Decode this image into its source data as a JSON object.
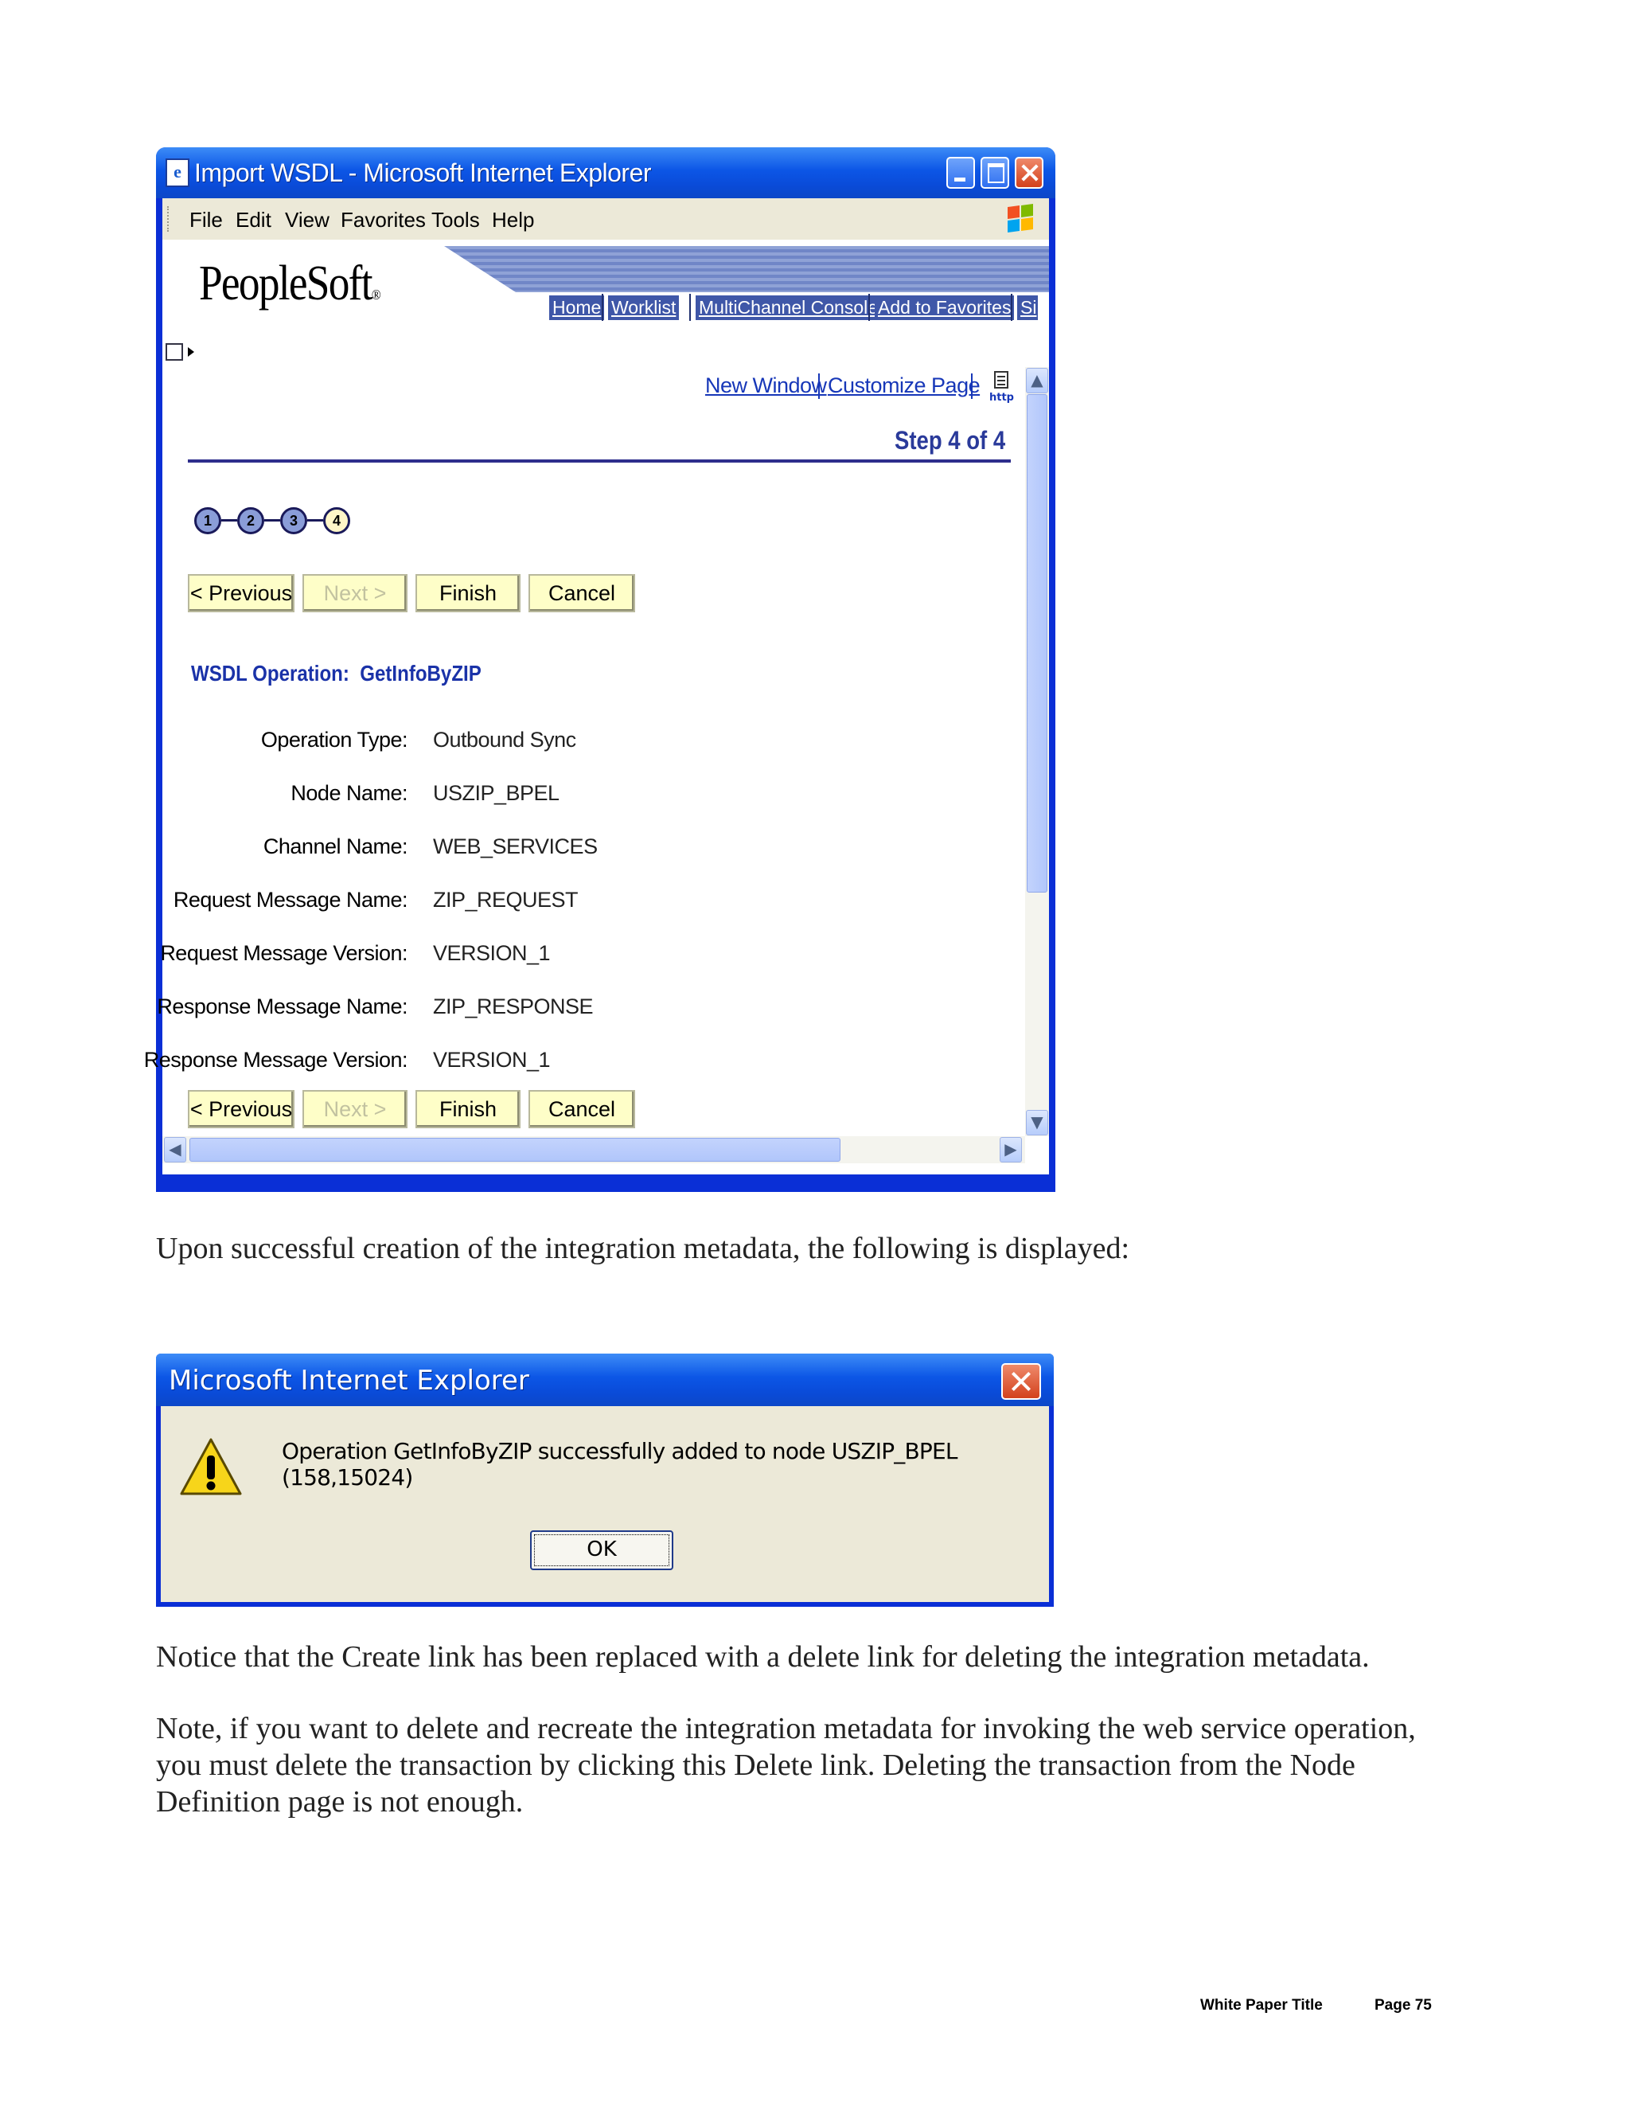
{
  "ie_window": {
    "title": "Import WSDL - Microsoft Internet Explorer",
    "menu": [
      "File",
      "Edit",
      "View",
      "Favorites",
      "Tools",
      "Help"
    ],
    "logo": "PeopleSoft",
    "logo_mark": "®",
    "nav_links": [
      "Home",
      "Worklist",
      "MultiChannel Console",
      "Add to Favorites",
      "Si"
    ],
    "page_links": {
      "new_window": "New Window",
      "customize_page": "Customize Page",
      "http_icon_label": "http"
    },
    "step_label": "Step 4 of 4",
    "steps": [
      "1",
      "2",
      "3",
      "4"
    ],
    "current_step": 4,
    "buttons": {
      "previous": "< Previous",
      "next": "Next >",
      "finish": "Finish",
      "cancel": "Cancel"
    },
    "wsdl_operation_label": "WSDL Operation:",
    "wsdl_operation_value": "GetInfoByZIP",
    "fields": [
      {
        "label": "Operation Type:",
        "value": "Outbound Sync"
      },
      {
        "label": "Node Name:",
        "value": "USZIP_BPEL"
      },
      {
        "label": "Channel Name:",
        "value": "WEB_SERVICES"
      },
      {
        "label": "Request Message Name:",
        "value": "ZIP_REQUEST"
      },
      {
        "label": "Request Message Version:",
        "value": "VERSION_1"
      },
      {
        "label": "Response Message Name:",
        "value": "ZIP_RESPONSE"
      },
      {
        "label": "Response Message Version:",
        "value": "VERSION_1"
      }
    ],
    "scroll": {
      "up": "▲",
      "down": "▼",
      "left": "◀",
      "right": "▶"
    }
  },
  "paragraphs": {
    "p1": "Upon successful creation of the integration metadata, the following is displayed:",
    "p2": "Notice that the Create link has been replaced with a delete link for deleting the integration metadata.",
    "p3": "Note, if you want to delete and recreate the integration metadata for invoking the web service operation, you must delete the transaction by clicking this Delete link. Deleting the transaction from the Node Definition page is not enough."
  },
  "message_box": {
    "title": "Microsoft Internet Explorer",
    "message": "Operation GetInfoByZIP successfully added to node USZIP_BPEL (158,15024)",
    "ok_label": "OK",
    "icon": "warning-icon"
  },
  "footer": {
    "doc_title": "White Paper Title",
    "page": "Page 75"
  },
  "colors": {
    "xp_title_blue": "#0c56e6",
    "link_blue": "#1737b8",
    "ps_button_yellow": "#fefec8",
    "dialog_bg": "#ece9d8"
  }
}
